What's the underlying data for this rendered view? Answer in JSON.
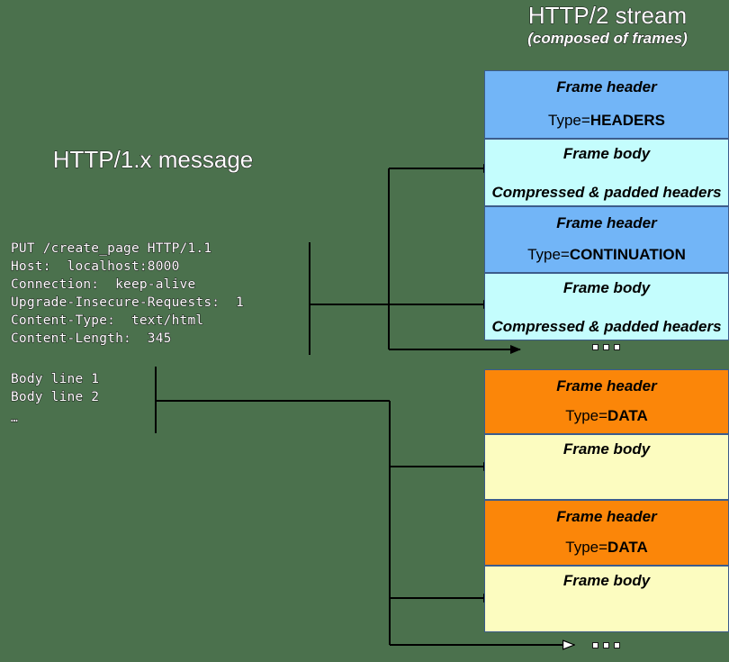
{
  "background_color": "#4b714d",
  "titles": {
    "stream": "HTTP/2 stream",
    "stream_sub": "(composed of frames)",
    "message": "HTTP/1.x message"
  },
  "http1_message": {
    "headers_text": "PUT /create_page HTTP/1.1\nHost:  localhost:8000\nConnection:  keep-alive\nUpgrade-Insecure-Requests:  1\nContent-Type:  text/html\nContent-Length:  345",
    "body_text": "Body line 1\nBody line 2",
    "ellipsis": "…"
  },
  "colors": {
    "header_blue": "#72b5f7",
    "body_cyan": "#c4fdfd",
    "header_orange": "#fb8609",
    "body_yellow": "#fcfcc0",
    "box_border": "#3c5c8c",
    "line": "#000000"
  },
  "frames": [
    {
      "id": "frame1",
      "header_label": "Frame header",
      "type_prefix": "Type=",
      "type_value": "HEADERS",
      "body_label": "Frame body",
      "body_text": "Compressed & padded headers"
    },
    {
      "id": "frame2",
      "header_label": "Frame header",
      "type_prefix": "Type=",
      "type_value": "CONTINUATION",
      "body_label": "Frame body",
      "body_text": "Compressed & padded headers"
    },
    {
      "id": "frame3",
      "header_label": "Frame header",
      "type_prefix": "Type=",
      "type_value": "DATA",
      "body_label": "Frame body",
      "body_text": ""
    },
    {
      "id": "frame4",
      "header_label": "Frame header",
      "type_prefix": "Type=",
      "type_value": "DATA",
      "body_label": "Frame body",
      "body_text": ""
    }
  ],
  "ellipsis_markers": {
    "headers_group": "...",
    "data_group": "..."
  }
}
